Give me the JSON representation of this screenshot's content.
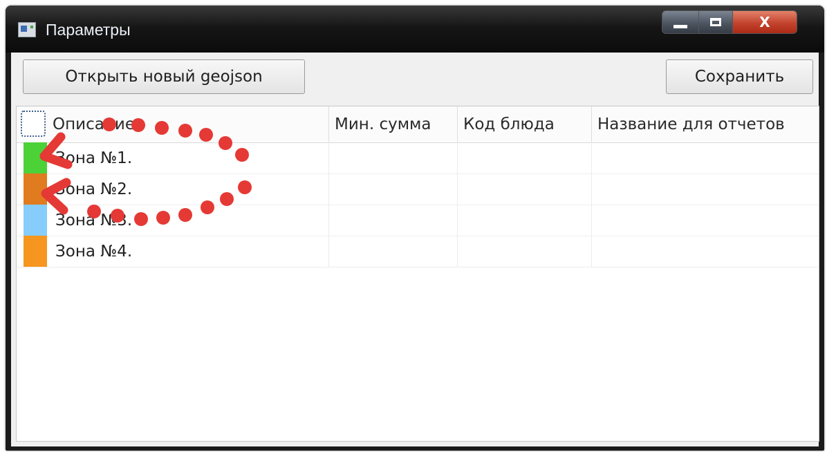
{
  "window": {
    "title": "Параметры",
    "icon": "app-window-icon",
    "controls": {
      "minimize": "minimize-icon",
      "maximize": "maximize-icon",
      "close_label": "X"
    }
  },
  "toolbar": {
    "open_label": "Открыть новый geojson",
    "save_label": "Сохранить"
  },
  "table": {
    "columns": [
      "Описание",
      "Мин. сумма",
      "Код блюда",
      "Название для отчетов"
    ],
    "rows": [
      {
        "color": "#4cd137",
        "description": "Зона №1.",
        "min_sum": "",
        "dish_code": "",
        "report_name": ""
      },
      {
        "color": "#e07b1f",
        "description": "Зона №2.",
        "min_sum": "",
        "dish_code": "",
        "report_name": ""
      },
      {
        "color": "#86cdfb",
        "description": "Зона №3.",
        "min_sum": "",
        "dish_code": "",
        "report_name": ""
      },
      {
        "color": "#f7961e",
        "description": "Зона №4.",
        "min_sum": "",
        "dish_code": "",
        "report_name": ""
      }
    ]
  },
  "annotation": {
    "color": "#e53935"
  }
}
